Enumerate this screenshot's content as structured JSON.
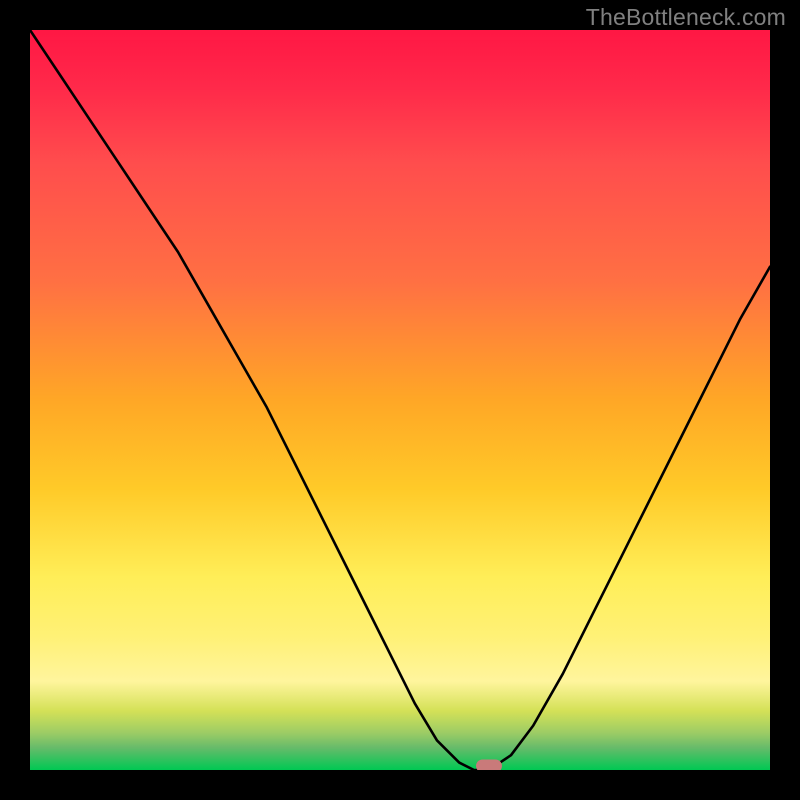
{
  "watermark": "TheBottleneck.com",
  "colors": {
    "frame": "#000000",
    "curve": "#000000",
    "marker": "#c97a7a",
    "gradient_top": "#ff1744",
    "gradient_bottom": "#00c853"
  },
  "chart_data": {
    "type": "line",
    "title": "",
    "xlabel": "",
    "ylabel": "",
    "xlim": [
      0,
      100
    ],
    "ylim": [
      0,
      100
    ],
    "grid": false,
    "legend": false,
    "marker": {
      "x": 62,
      "y": 0
    },
    "series": [
      {
        "name": "bottleneck-curve",
        "x": [
          0,
          4,
          8,
          12,
          16,
          20,
          24,
          28,
          32,
          36,
          40,
          44,
          48,
          52,
          55,
          58,
          60,
          62,
          65,
          68,
          72,
          76,
          80,
          84,
          88,
          92,
          96,
          100
        ],
        "y": [
          100,
          94,
          88,
          82,
          76,
          70,
          63,
          56,
          49,
          41,
          33,
          25,
          17,
          9,
          4,
          1,
          0,
          0,
          2,
          6,
          13,
          21,
          29,
          37,
          45,
          53,
          61,
          68
        ]
      }
    ]
  }
}
